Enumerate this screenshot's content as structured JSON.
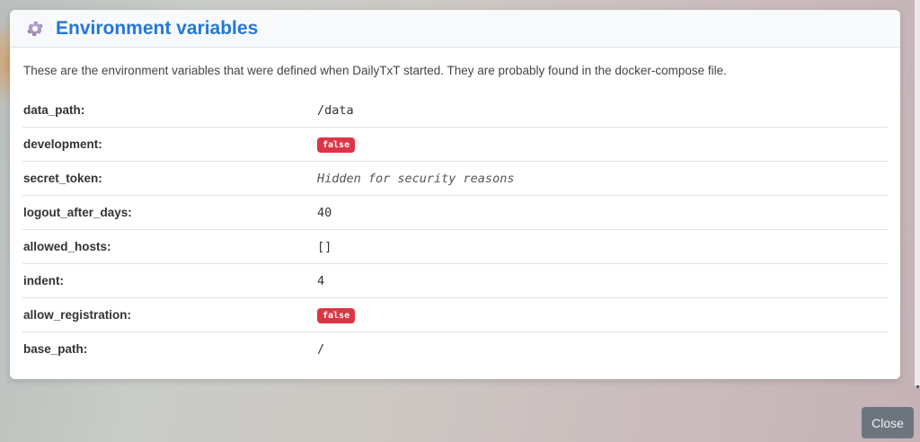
{
  "modal": {
    "title": "Environment variables",
    "icon": "gear-icon",
    "intro": "These are the environment variables that were defined when DailyTxT started. They are probably found in the docker-compose file."
  },
  "variables": [
    {
      "key": "data_path:",
      "value": "/data",
      "type": "text"
    },
    {
      "key": "development:",
      "value": "false",
      "type": "badge"
    },
    {
      "key": "secret_token:",
      "value": "Hidden for security reasons",
      "type": "italic"
    },
    {
      "key": "logout_after_days:",
      "value": "40",
      "type": "text"
    },
    {
      "key": "allowed_hosts:",
      "value": "[]",
      "type": "text"
    },
    {
      "key": "indent:",
      "value": "4",
      "type": "text"
    },
    {
      "key": "allow_registration:",
      "value": "false",
      "type": "badge"
    },
    {
      "key": "base_path:",
      "value": "/",
      "type": "text"
    }
  ],
  "footer": {
    "close_label": "Close"
  },
  "colors": {
    "title": "#2378d8",
    "badge_false": "#dc3545",
    "close_button": "#6c757d"
  }
}
